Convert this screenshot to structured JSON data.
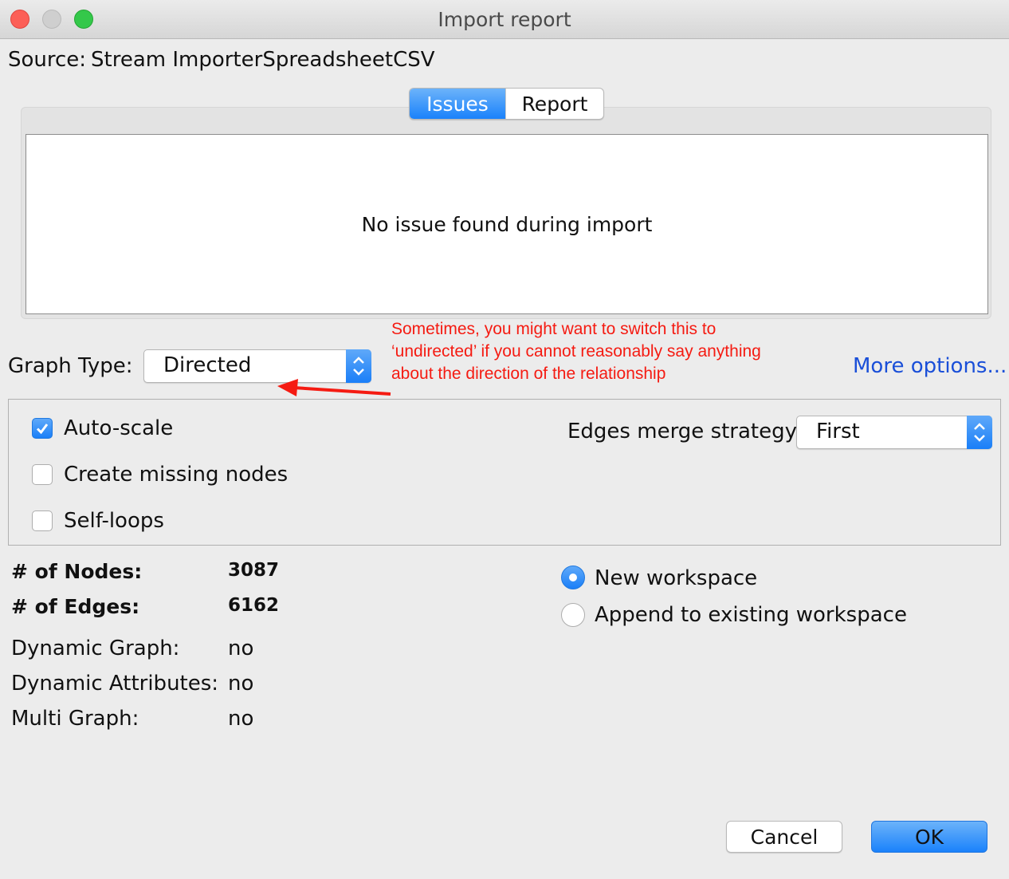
{
  "window": {
    "title": "Import report"
  },
  "source": {
    "label": "Source:",
    "value": "Stream ImporterSpreadsheetCSV"
  },
  "tabs": {
    "issues": "Issues",
    "report": "Report"
  },
  "issues": {
    "message": "No issue found during import"
  },
  "graph_type": {
    "label": "Graph Type:",
    "value": "Directed"
  },
  "annotation": {
    "text": "Sometimes, you might want to switch this to ‘undirected’ if you cannot reasonably say anything about the direction of the relationship"
  },
  "more_options": "More options...",
  "options": {
    "auto_scale": {
      "label": "Auto-scale",
      "checked": true
    },
    "create_missing_nodes": {
      "label": "Create missing nodes",
      "checked": false
    },
    "self_loops": {
      "label": "Self-loops",
      "checked": false
    },
    "edges_merge": {
      "label": "Edges merge strategy:",
      "value": "First"
    }
  },
  "stats": {
    "nodes_label": "# of Nodes:",
    "nodes_value": "3087",
    "edges_label": "# of Edges:",
    "edges_value": "6162",
    "dynamic_graph_label": "Dynamic Graph:",
    "dynamic_graph_value": "no",
    "dynamic_attributes_label": "Dynamic Attributes:",
    "dynamic_attributes_value": "no",
    "multi_graph_label": "Multi Graph:",
    "multi_graph_value": "no"
  },
  "workspace": {
    "new": {
      "label": "New workspace",
      "selected": true
    },
    "append": {
      "label": "Append to existing workspace",
      "selected": false
    }
  },
  "buttons": {
    "cancel": "Cancel",
    "ok": "OK"
  },
  "colors": {
    "accent": "#1a82fb",
    "annotation": "#f51b12",
    "link": "#1a4fd8"
  }
}
